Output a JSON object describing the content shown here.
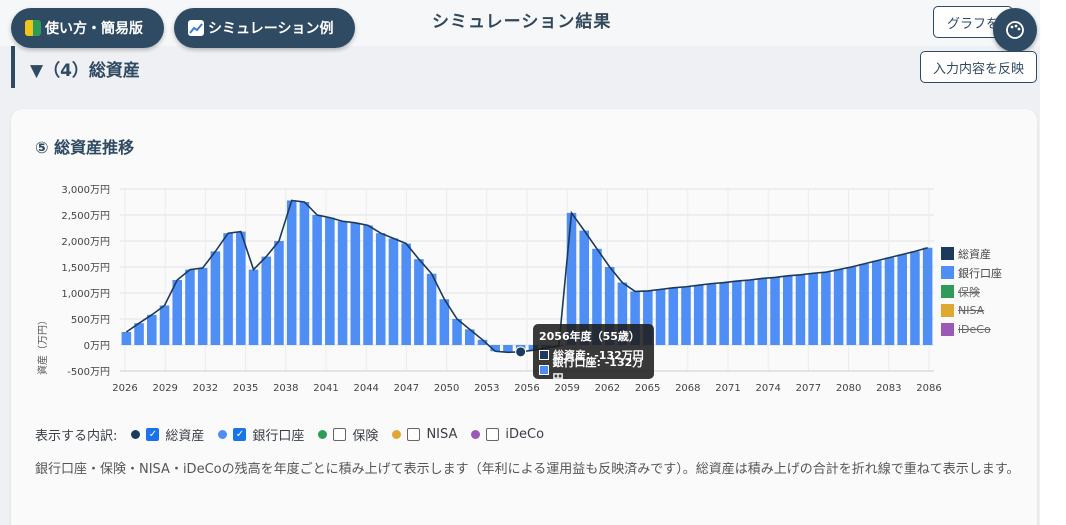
{
  "header": {
    "usage_label": "使い方・簡易版",
    "simulation_label": "シミュレーション例",
    "title": "シミュレーション結果",
    "graph_button": "グラフを",
    "apply_button": "入力内容を反映"
  },
  "section": {
    "title": "▼（4）総資産"
  },
  "card": {
    "title": "⑤ 総資産推移"
  },
  "colors": {
    "total": "#1b3a5c",
    "bank": "#4f8ef5",
    "insurance": "#2e9b58",
    "nisa": "#e0a830",
    "ideco": "#9b59b6",
    "tooltip_bg": "#1e1e1e"
  },
  "chart_data": {
    "type": "bar",
    "ylabel": "資産（万円）",
    "ylim": [
      -500,
      3000
    ],
    "yticks": [
      "3,000万円",
      "2,500万円",
      "2,000万円",
      "1,500万円",
      "1,000万円",
      "500万円",
      "0万円",
      "-500万円"
    ],
    "ytick_values": [
      3000,
      2500,
      2000,
      1500,
      1000,
      500,
      0,
      -500
    ],
    "xtick_labels": [
      "2026",
      "2029",
      "2032",
      "2035",
      "2038",
      "2041",
      "2044",
      "2047",
      "2050",
      "2053",
      "2056",
      "2059",
      "2062",
      "2065",
      "2068",
      "2071",
      "2074",
      "2077",
      "2080",
      "2083",
      "2086"
    ],
    "x_start": 2026,
    "x_end": 2086,
    "series": [
      {
        "name": "総資産",
        "type": "line",
        "values": [
          250,
          420,
          580,
          760,
          1250,
          1450,
          1480,
          1800,
          2150,
          2180,
          1450,
          1700,
          2000,
          2780,
          2750,
          2500,
          2450,
          2380,
          2350,
          2300,
          2150,
          2050,
          1950,
          1650,
          1370,
          880,
          500,
          300,
          100,
          -120,
          -140,
          -132,
          -100,
          -60,
          -20,
          2540,
          2200,
          1850,
          1500,
          1200,
          1030,
          1040,
          1070,
          1100,
          1120,
          1150,
          1180,
          1200,
          1230,
          1250,
          1280,
          1300,
          1330,
          1350,
          1380,
          1400,
          1450,
          1500,
          1560,
          1620,
          1680,
          1740,
          1800,
          1870
        ]
      },
      {
        "name": "銀行口座",
        "type": "bar",
        "values": [
          250,
          420,
          580,
          760,
          1250,
          1450,
          1480,
          1800,
          2150,
          2180,
          1450,
          1700,
          2000,
          2780,
          2750,
          2500,
          2450,
          2380,
          2350,
          2300,
          2150,
          2050,
          1950,
          1650,
          1370,
          880,
          500,
          300,
          100,
          -120,
          -140,
          -132,
          -100,
          -60,
          -20,
          2540,
          2200,
          1850,
          1500,
          1200,
          1030,
          1040,
          1070,
          1100,
          1120,
          1150,
          1180,
          1200,
          1230,
          1250,
          1280,
          1300,
          1330,
          1350,
          1380,
          1400,
          1450,
          1500,
          1560,
          1620,
          1680,
          1740,
          1800,
          1870
        ]
      }
    ],
    "legend": [
      {
        "name": "総資産",
        "visible": true
      },
      {
        "name": "銀行口座",
        "visible": true
      },
      {
        "name": "保険",
        "visible": false
      },
      {
        "name": "NISA",
        "visible": false
      },
      {
        "name": "iDeCo",
        "visible": false
      }
    ],
    "tooltip": {
      "title": "2056年度（55歳）",
      "line1": "総資産: -132万円",
      "line2": "銀行口座: -132万円"
    },
    "grid": true,
    "legend_position": "right"
  },
  "toggles": {
    "label": "表示する内訳:",
    "items": [
      {
        "name": "総資産",
        "checked": true
      },
      {
        "name": "銀行口座",
        "checked": true
      },
      {
        "name": "保険",
        "checked": false
      },
      {
        "name": "NISA",
        "checked": false
      },
      {
        "name": "iDeCo",
        "checked": false
      }
    ]
  },
  "note": "銀行口座・保険・NISA・iDeCoの残高を年度ごとに積み上げて表示します（年利による運用益も反映済みです）。総資産は積み上げの合計を折れ線で重ねて表示します。"
}
